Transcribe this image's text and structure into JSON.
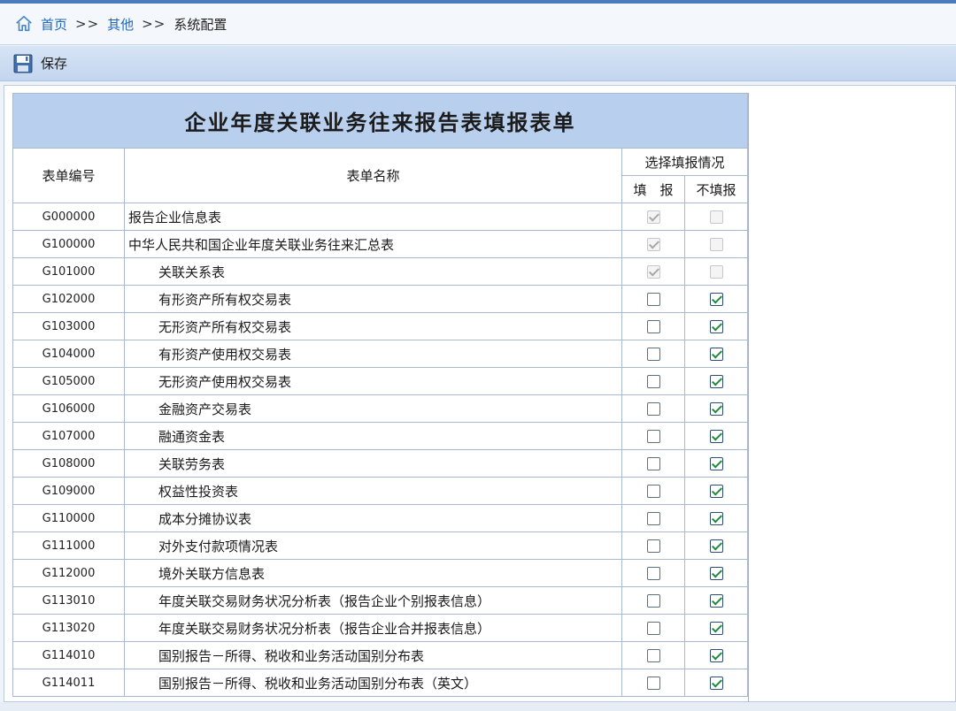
{
  "breadcrumb": {
    "home": "首页",
    "separator": ">>",
    "level2": "其他",
    "current": "系统配置"
  },
  "toolbar": {
    "save_label": "保存"
  },
  "form": {
    "title": "企业年度关联业务往来报告表填报表单",
    "headers": {
      "code": "表单编号",
      "name": "表单名称",
      "select": "选择填报情况",
      "fill": "填　报",
      "nofill": "不填报"
    },
    "rows": [
      {
        "code": "G000000",
        "name": "报告企业信息表",
        "sub": false,
        "fill": true,
        "nofill": false,
        "locked": true
      },
      {
        "code": "G100000",
        "name": "中华人民共和国企业年度关联业务往来汇总表",
        "sub": false,
        "fill": true,
        "nofill": false,
        "locked": true
      },
      {
        "code": "G101000",
        "name": "关联关系表",
        "sub": true,
        "fill": true,
        "nofill": false,
        "locked": true
      },
      {
        "code": "G102000",
        "name": "有形资产所有权交易表",
        "sub": true,
        "fill": false,
        "nofill": true,
        "locked": false
      },
      {
        "code": "G103000",
        "name": "无形资产所有权交易表",
        "sub": true,
        "fill": false,
        "nofill": true,
        "locked": false
      },
      {
        "code": "G104000",
        "name": "有形资产使用权交易表",
        "sub": true,
        "fill": false,
        "nofill": true,
        "locked": false
      },
      {
        "code": "G105000",
        "name": "无形资产使用权交易表",
        "sub": true,
        "fill": false,
        "nofill": true,
        "locked": false
      },
      {
        "code": "G106000",
        "name": "金融资产交易表",
        "sub": true,
        "fill": false,
        "nofill": true,
        "locked": false
      },
      {
        "code": "G107000",
        "name": "融通资金表",
        "sub": true,
        "fill": false,
        "nofill": true,
        "locked": false
      },
      {
        "code": "G108000",
        "name": "关联劳务表",
        "sub": true,
        "fill": false,
        "nofill": true,
        "locked": false
      },
      {
        "code": "G109000",
        "name": "权益性投资表",
        "sub": true,
        "fill": false,
        "nofill": true,
        "locked": false
      },
      {
        "code": "G110000",
        "name": "成本分摊协议表",
        "sub": true,
        "fill": false,
        "nofill": true,
        "locked": false
      },
      {
        "code": "G111000",
        "name": "对外支付款项情况表",
        "sub": true,
        "fill": false,
        "nofill": true,
        "locked": false
      },
      {
        "code": "G112000",
        "name": "境外关联方信息表",
        "sub": true,
        "fill": false,
        "nofill": true,
        "locked": false
      },
      {
        "code": "G113010",
        "name": "年度关联交易财务状况分析表（报告企业个别报表信息）",
        "sub": true,
        "fill": false,
        "nofill": true,
        "locked": false
      },
      {
        "code": "G113020",
        "name": "年度关联交易财务状况分析表（报告企业合并报表信息）",
        "sub": true,
        "fill": false,
        "nofill": true,
        "locked": false
      },
      {
        "code": "G114010",
        "name": "国别报告－所得、税收和业务活动国别分布表",
        "sub": true,
        "fill": false,
        "nofill": true,
        "locked": false
      },
      {
        "code": "G114011",
        "name": "国别报告－所得、税收和业务活动国别分布表（英文）",
        "sub": true,
        "fill": false,
        "nofill": true,
        "locked": false
      }
    ]
  },
  "colors": {
    "accent": "#1f66c1",
    "header_bg": "#b8cfee",
    "toolbar_bg": "#c3d6ef"
  }
}
